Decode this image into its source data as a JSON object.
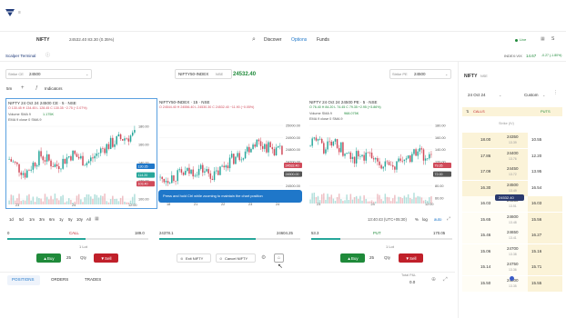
{
  "header": {
    "logo": "trade-logo",
    "symbol": "NIFTY",
    "symbol_price": "24532.40 83.30 (0.35%)",
    "nav": [
      "Discover",
      "Options",
      "Funds"
    ],
    "live": "Live",
    "avatar": "S"
  },
  "sub_header": {
    "terminal_tab": "Scalper Terminal",
    "index_label": "INDEX:VIX",
    "index_value": "14.67",
    "index_change": "-0.27 (-1.80%)"
  },
  "controls": {
    "strike_ce_label": "Strike CE",
    "strike_ce_value": "24500",
    "center_symbol": "NIFTY50-INDEX",
    "center_symbol_sub": "NSE",
    "center_price": "24532.40",
    "strike_pe_label": "Strike PE",
    "strike_pe_value": "24500",
    "interval": "5m",
    "indicators": "Indicators"
  },
  "charts": [
    {
      "title": "NIFTY 24 Oct 24 24500 CE · 5 · NSE",
      "ohlc": "O 130.45 H 134.45 L 128.45 C 130.35 −2.75 (−2.07%)",
      "vol": "Volume SMA 9",
      "vol_val": "1.175K",
      "ema": "EMA 9 close 0 SMA 9",
      "y_ticks": [
        "180.00",
        "160.00",
        "140.00",
        "120.00",
        "100.00"
      ],
      "price_tags": [
        {
          "v": "130.35",
          "c": "#1f77c9"
        },
        {
          "v": "114.20",
          "c": "#26a69a"
        },
        {
          "v": "103.40",
          "c": "#d04a5a"
        }
      ],
      "x_ticks": [
        "23",
        "24",
        "12:00"
      ]
    },
    {
      "title": "NIFTY50-INDEX · 15 · NSE",
      "ohlc": "O 24544.40 H 24556.40 L 24530.30 C 24532.40 −11.90 (−0.05%)",
      "vol": "",
      "vol_val": "",
      "ema": "",
      "y_ticks": [
        "25000.00",
        "24900.00",
        "24800.00",
        "24700.00",
        "24600.00",
        "24500.00",
        "24400.00"
      ],
      "price_tags": [
        {
          "v": "24532.40",
          "c": "#d04a5a"
        },
        {
          "v": "24500.00",
          "c": "#555"
        }
      ],
      "x_ticks": [
        "18",
        "21",
        "22",
        "23",
        "24"
      ]
    },
    {
      "title": "NIFTY 24 Oct 24 24500 PE · 5 · NSE",
      "ohlc": "O 76.40 H 84.20 L 74.45 C 79.35 +2.95 (+3.86%)",
      "vol": "Volume SMA 9",
      "vol_val": "968.075K",
      "ema": "EMA 9 close 0 SMA 9",
      "y_ticks": [
        "180.00",
        "160.00",
        "140.00",
        "120.00",
        "100.00",
        "80.00",
        "60.00"
      ],
      "price_tags": [
        {
          "v": "79.35",
          "c": "#d04a5a"
        },
        {
          "v": "72.00",
          "c": "#555"
        }
      ],
      "x_ticks": [
        "23",
        "24",
        "12:00"
      ]
    }
  ],
  "timeframes": [
    "1d",
    "5d",
    "1m",
    "3m",
    "6m",
    "1y",
    "5y",
    "10y",
    "All"
  ],
  "clock": "13:40:43 (UTC+05:30)",
  "axis_modes": [
    "%",
    "log",
    "auto"
  ],
  "tooltip": "Press and hold Ctrl while zooming to maintain the chart position",
  "ltp_bars": {
    "call": {
      "label": "CALL",
      "left": "0",
      "right": "189.0"
    },
    "index": {
      "left": "24378.1",
      "right": "24604.25"
    },
    "put": {
      "label": "PUT",
      "left": "53.3",
      "right": "170.05"
    }
  },
  "order_panel": {
    "call": {
      "buy": "Buy",
      "qty_value": "25",
      "qty_label": "Qty",
      "sell": "Sell",
      "lot": "1 Lot"
    },
    "put": {
      "buy": "Buy",
      "qty_value": "25",
      "qty_label": "Qty",
      "sell": "Sell",
      "lot": "1 Lot"
    },
    "exit_all": "Exit NIFTY",
    "cancel_all": "Cancel NIFTY"
  },
  "bottom_tabs": [
    "POSITIONS",
    "ORDERS",
    "TRADES"
  ],
  "pnl": {
    "label": "Total P&L",
    "value": "0.0"
  },
  "option_chain": {
    "title": "NIFTY",
    "exchange": "NSE",
    "expiry": "24 Oct 24",
    "mode": "Custom",
    "calls": "CALLS",
    "puts": "PUTS",
    "strike_header": "Strike (IV)",
    "spot": "24532.40",
    "rows": [
      {
        "call": "18.00",
        "strike": "24350",
        "iv": "13.39",
        "put": "10.55"
      },
      {
        "call": "17.86",
        "strike": "24400",
        "iv": "13.76",
        "put": "12.20"
      },
      {
        "call": "17.09",
        "strike": "24450",
        "iv": "13.72",
        "put": "13.95"
      },
      {
        "call": "16.30",
        "strike": "24500",
        "iv": "13.49",
        "put": "16.54"
      },
      {
        "call": "16.03",
        "strike": "24550",
        "iv": "13.51",
        "put": "16.03"
      },
      {
        "call": "15.65",
        "strike": "24600",
        "iv": "13.48",
        "put": "15.56"
      },
      {
        "call": "15.46",
        "strike": "24650",
        "iv": "13.41",
        "put": "16.27"
      },
      {
        "call": "15.06",
        "strike": "24700",
        "iv": "13.38",
        "put": "15.16"
      },
      {
        "call": "15.14",
        "strike": "24750",
        "iv": "13.36",
        "put": "15.71"
      },
      {
        "call": "15.50",
        "strike": "24800",
        "iv": "13.35",
        "put": "15.55"
      }
    ]
  },
  "colors": {
    "buy": "#1f8a3a",
    "sell": "#c0202a",
    "up": "#26a69a",
    "down": "#d04a5a",
    "accent": "#1f77c9"
  }
}
